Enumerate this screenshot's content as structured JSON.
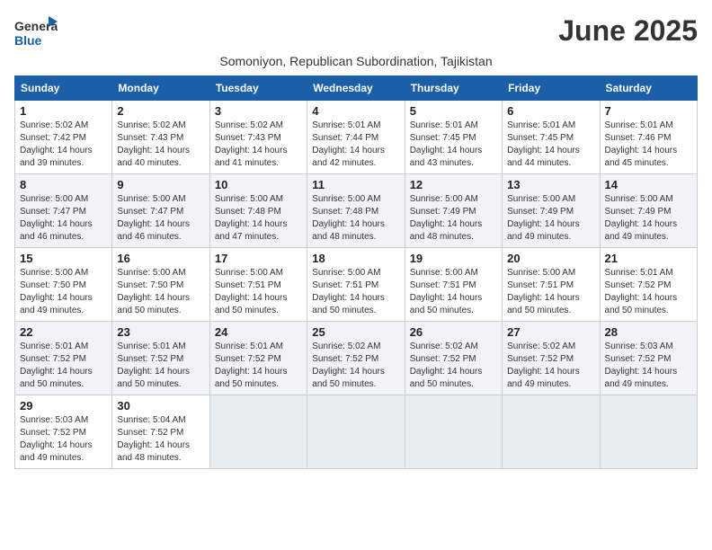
{
  "header": {
    "logo_general": "General",
    "logo_blue": "Blue",
    "month_title": "June 2025",
    "subtitle": "Somoniyon, Republican Subordination, Tajikistan"
  },
  "weekdays": [
    "Sunday",
    "Monday",
    "Tuesday",
    "Wednesday",
    "Thursday",
    "Friday",
    "Saturday"
  ],
  "weeks": [
    [
      {
        "day": "1",
        "sunrise": "Sunrise: 5:02 AM",
        "sunset": "Sunset: 7:42 PM",
        "daylight": "Daylight: 14 hours and 39 minutes."
      },
      {
        "day": "2",
        "sunrise": "Sunrise: 5:02 AM",
        "sunset": "Sunset: 7:43 PM",
        "daylight": "Daylight: 14 hours and 40 minutes."
      },
      {
        "day": "3",
        "sunrise": "Sunrise: 5:02 AM",
        "sunset": "Sunset: 7:43 PM",
        "daylight": "Daylight: 14 hours and 41 minutes."
      },
      {
        "day": "4",
        "sunrise": "Sunrise: 5:01 AM",
        "sunset": "Sunset: 7:44 PM",
        "daylight": "Daylight: 14 hours and 42 minutes."
      },
      {
        "day": "5",
        "sunrise": "Sunrise: 5:01 AM",
        "sunset": "Sunset: 7:45 PM",
        "daylight": "Daylight: 14 hours and 43 minutes."
      },
      {
        "day": "6",
        "sunrise": "Sunrise: 5:01 AM",
        "sunset": "Sunset: 7:45 PM",
        "daylight": "Daylight: 14 hours and 44 minutes."
      },
      {
        "day": "7",
        "sunrise": "Sunrise: 5:01 AM",
        "sunset": "Sunset: 7:46 PM",
        "daylight": "Daylight: 14 hours and 45 minutes."
      }
    ],
    [
      {
        "day": "8",
        "sunrise": "Sunrise: 5:00 AM",
        "sunset": "Sunset: 7:47 PM",
        "daylight": "Daylight: 14 hours and 46 minutes."
      },
      {
        "day": "9",
        "sunrise": "Sunrise: 5:00 AM",
        "sunset": "Sunset: 7:47 PM",
        "daylight": "Daylight: 14 hours and 46 minutes."
      },
      {
        "day": "10",
        "sunrise": "Sunrise: 5:00 AM",
        "sunset": "Sunset: 7:48 PM",
        "daylight": "Daylight: 14 hours and 47 minutes."
      },
      {
        "day": "11",
        "sunrise": "Sunrise: 5:00 AM",
        "sunset": "Sunset: 7:48 PM",
        "daylight": "Daylight: 14 hours and 48 minutes."
      },
      {
        "day": "12",
        "sunrise": "Sunrise: 5:00 AM",
        "sunset": "Sunset: 7:49 PM",
        "daylight": "Daylight: 14 hours and 48 minutes."
      },
      {
        "day": "13",
        "sunrise": "Sunrise: 5:00 AM",
        "sunset": "Sunset: 7:49 PM",
        "daylight": "Daylight: 14 hours and 49 minutes."
      },
      {
        "day": "14",
        "sunrise": "Sunrise: 5:00 AM",
        "sunset": "Sunset: 7:49 PM",
        "daylight": "Daylight: 14 hours and 49 minutes."
      }
    ],
    [
      {
        "day": "15",
        "sunrise": "Sunrise: 5:00 AM",
        "sunset": "Sunset: 7:50 PM",
        "daylight": "Daylight: 14 hours and 49 minutes."
      },
      {
        "day": "16",
        "sunrise": "Sunrise: 5:00 AM",
        "sunset": "Sunset: 7:50 PM",
        "daylight": "Daylight: 14 hours and 50 minutes."
      },
      {
        "day": "17",
        "sunrise": "Sunrise: 5:00 AM",
        "sunset": "Sunset: 7:51 PM",
        "daylight": "Daylight: 14 hours and 50 minutes."
      },
      {
        "day": "18",
        "sunrise": "Sunrise: 5:00 AM",
        "sunset": "Sunset: 7:51 PM",
        "daylight": "Daylight: 14 hours and 50 minutes."
      },
      {
        "day": "19",
        "sunrise": "Sunrise: 5:00 AM",
        "sunset": "Sunset: 7:51 PM",
        "daylight": "Daylight: 14 hours and 50 minutes."
      },
      {
        "day": "20",
        "sunrise": "Sunrise: 5:00 AM",
        "sunset": "Sunset: 7:51 PM",
        "daylight": "Daylight: 14 hours and 50 minutes."
      },
      {
        "day": "21",
        "sunrise": "Sunrise: 5:01 AM",
        "sunset": "Sunset: 7:52 PM",
        "daylight": "Daylight: 14 hours and 50 minutes."
      }
    ],
    [
      {
        "day": "22",
        "sunrise": "Sunrise: 5:01 AM",
        "sunset": "Sunset: 7:52 PM",
        "daylight": "Daylight: 14 hours and 50 minutes."
      },
      {
        "day": "23",
        "sunrise": "Sunrise: 5:01 AM",
        "sunset": "Sunset: 7:52 PM",
        "daylight": "Daylight: 14 hours and 50 minutes."
      },
      {
        "day": "24",
        "sunrise": "Sunrise: 5:01 AM",
        "sunset": "Sunset: 7:52 PM",
        "daylight": "Daylight: 14 hours and 50 minutes."
      },
      {
        "day": "25",
        "sunrise": "Sunrise: 5:02 AM",
        "sunset": "Sunset: 7:52 PM",
        "daylight": "Daylight: 14 hours and 50 minutes."
      },
      {
        "day": "26",
        "sunrise": "Sunrise: 5:02 AM",
        "sunset": "Sunset: 7:52 PM",
        "daylight": "Daylight: 14 hours and 50 minutes."
      },
      {
        "day": "27",
        "sunrise": "Sunrise: 5:02 AM",
        "sunset": "Sunset: 7:52 PM",
        "daylight": "Daylight: 14 hours and 49 minutes."
      },
      {
        "day": "28",
        "sunrise": "Sunrise: 5:03 AM",
        "sunset": "Sunset: 7:52 PM",
        "daylight": "Daylight: 14 hours and 49 minutes."
      }
    ],
    [
      {
        "day": "29",
        "sunrise": "Sunrise: 5:03 AM",
        "sunset": "Sunset: 7:52 PM",
        "daylight": "Daylight: 14 hours and 49 minutes."
      },
      {
        "day": "30",
        "sunrise": "Sunrise: 5:04 AM",
        "sunset": "Sunset: 7:52 PM",
        "daylight": "Daylight: 14 hours and 48 minutes."
      },
      null,
      null,
      null,
      null,
      null
    ]
  ]
}
